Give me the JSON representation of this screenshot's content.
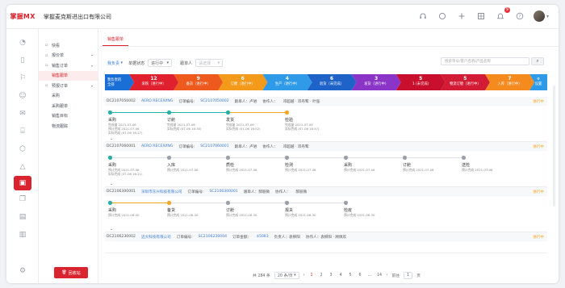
{
  "app": {
    "logo": "掌握MX",
    "company": "掌握麦克斯进出口有限公司",
    "notification_count": "9"
  },
  "top_icons": [
    "headset-icon",
    "chat-icon",
    "plus-icon",
    "grid-icon",
    "bell-icon",
    "help-icon"
  ],
  "menu": {
    "items": [
      {
        "label": "快看",
        "icon": "eye-icon",
        "type": "root"
      },
      {
        "label": "报价单",
        "icon": "doc-icon",
        "type": "group"
      },
      {
        "label": "销售订单",
        "icon": "cart-icon",
        "type": "group"
      },
      {
        "label": "销售跟单",
        "icon": "",
        "type": "sub",
        "active": true
      },
      {
        "label": "预报订单",
        "icon": "list-icon",
        "type": "group"
      },
      {
        "label": "采购",
        "icon": "",
        "type": "sub"
      },
      {
        "label": "采购跟单",
        "icon": "",
        "type": "sub"
      },
      {
        "label": "销售目标",
        "icon": "",
        "type": "sub"
      },
      {
        "label": "物流跟踪",
        "icon": "",
        "type": "sub"
      }
    ],
    "recycle_label": "回收站"
  },
  "tab": {
    "label": "销售跟单"
  },
  "filter": {
    "scope_label": "我负责",
    "status_label": "单据状态",
    "status_value": "进行中",
    "owner_label": "跟单人",
    "owner_placeholder": "请选择",
    "search_placeholder": "搜索单号/客户名称/产品名称"
  },
  "stages": [
    {
      "num": "",
      "label": "全部",
      "top": "我负责的",
      "color": "#1a6fd6"
    },
    {
      "num": "12",
      "label": "采购（进行中）",
      "color": "#e0202e"
    },
    {
      "num": "9",
      "label": "备货（进行中）",
      "color": "#ee5a1e"
    },
    {
      "num": "6",
      "label": "订舱（进行中）",
      "color": "#f39a1b"
    },
    {
      "num": "4",
      "label": "生产（进行中）",
      "color": "#2f9be8"
    },
    {
      "num": "6",
      "label": "验货（未完成）",
      "color": "#1f63c9"
    },
    {
      "num": "3",
      "label": "发货（进行中）",
      "color": "#8a35c7"
    },
    {
      "num": "5",
      "label": "1 (未完成)",
      "color": "#c8102e"
    },
    {
      "num": "5",
      "label": "物流订舱（进行中）",
      "color": "#d21c36"
    },
    {
      "num": "7",
      "label": "入库（进行中）",
      "color": "#f58a1e"
    },
    {
      "num": "",
      "label": "设置",
      "top": "⚙",
      "color": "#2f9be8"
    }
  ],
  "orders": [
    {
      "id": "DC2107050002",
      "company": "AERO RECEIVING",
      "order_label": "订单编号:",
      "order_no": "SC2107050002",
      "owner": "跟单人：卢进",
      "partner": "协作人：",
      "extra": "邓超越 · 邓丹鹭 · 叶强",
      "status": "进行中",
      "steps": [
        {
          "name": "采购",
          "info": [
            "完成量 2021-07-06",
            "预计完成 2021-07-06",
            "实际完成 (07-06 16:17)"
          ],
          "state": "teal"
        },
        {
          "name": "订舱",
          "info": [
            "完成量 2021-07-06",
            "实际完成 (07-06 16:30)"
          ],
          "state": "teal"
        },
        {
          "name": "发货",
          "info": [
            "完成量 2021-07-06",
            "实际完成 (07-06 16:52)"
          ],
          "state": "teal"
        },
        {
          "name": "检验",
          "info": [
            "完成量 2021-07-06",
            "实际完成 (07-06 16:57)"
          ],
          "state": "orange"
        }
      ]
    },
    {
      "id": "DC2107060001",
      "company": "AERO RECEIVING",
      "order_label": "订单编号:",
      "order_no": "SC2107060001",
      "owner": "跟单人：卢进",
      "partner": "协作人：",
      "extra": "邓超越 · 邓丹鹭",
      "status": "进行中",
      "steps": [
        {
          "name": "采购",
          "info": [
            "预计完成 2021-07-06",
            "实际完成 (07-06 16:21)"
          ],
          "state": "teal"
        },
        {
          "name": "入库",
          "info": [
            "预计完成 2021-07-06"
          ],
          "state": "gray"
        },
        {
          "name": "质检",
          "info": [
            "预计完成 2021-07-06"
          ],
          "state": "gray"
        },
        {
          "name": "检测",
          "info": [
            "预计完成 2021-07-06"
          ],
          "state": "gray"
        },
        {
          "name": "采购",
          "info": [
            "预计完成 2021-07-06"
          ],
          "state": "gray"
        },
        {
          "name": "订舱",
          "info": [
            "预计完成 2021-07-06"
          ],
          "state": "gray"
        },
        {
          "name": "送检",
          "info": [
            "预计完成 2021-07-06"
          ],
          "state": "gray"
        }
      ]
    },
    {
      "id": "DC2106300001",
      "company": "深圳市东兴科技有限公司",
      "order_label": "订单编号:",
      "order_no": "SC2106300001",
      "owner": "跟单人：郝丽微",
      "partner": "协作人：",
      "extra": "郝丽微",
      "status": "进行中",
      "steps": [
        {
          "name": "采购",
          "info": [
            "预计完成 2021-06-30"
          ],
          "state": "teal"
        },
        {
          "name": "备货",
          "info": [
            "预计完成 2021-06-30"
          ],
          "state": "orange"
        },
        {
          "name": "订舱",
          "info": [
            "预计完成 2021-06-30"
          ],
          "state": "gray"
        },
        {
          "name": "报关",
          "info": [
            "预计完成 2021-06-30"
          ],
          "state": "gray"
        },
        {
          "name": "检疫",
          "info": [
            "预计完成 2021-06-30"
          ],
          "state": "gray"
        }
      ]
    },
    {
      "id": "DC2106230002",
      "company": "迈大科技有限公司",
      "order_label": "订单编号:",
      "order_no": "SC2106230004",
      "owner": "订单金额：",
      "owner_value": "$5083",
      "partner": "负责人：袁柳阳",
      "extra": "协作人：袁柳阳 · 顾佩欢",
      "status": "进行中",
      "steps": []
    }
  ],
  "pager": {
    "total": "共 284 条",
    "page_size": "20 条/页",
    "pages": [
      "1",
      "2",
      "3",
      "4",
      "5",
      "6",
      "…",
      "14"
    ],
    "current": "1",
    "goto_label": "前往",
    "goto_value": "1",
    "goto_suffix": "页"
  }
}
